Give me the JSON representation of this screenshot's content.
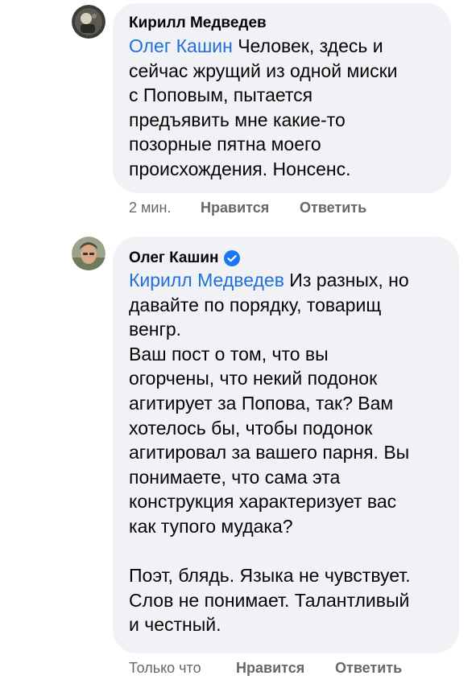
{
  "comments": [
    {
      "author": "Кирилл Медведев",
      "mention": "Олег Кашин",
      "lines": [
        " Человек, здесь и",
        "сейчас жрущий из одной миски",
        "с Поповым, пытается",
        "предъявить мне какие-то",
        "позорные пятна моего",
        "происхождения. Нонсенс."
      ],
      "time": "2 мин.",
      "like_label": "Нравится",
      "reply_label": "Ответить"
    },
    {
      "author": "Олег Кашин",
      "verified": true,
      "mention": "Кирилл Медведев",
      "lines": [
        " Из разных, но",
        "давайте по порядку, товарищ",
        "венгр.",
        "Ваш пост о том, что вы",
        "огорчены, что некий подонок",
        "агитирует за Попова, так? Вам",
        "хотелось бы, чтобы подонок",
        "агитировал за вашего парня. Вы",
        "понимаете, что сама эта",
        "конструкция характеризует вас",
        "как тупого мудака?",
        "",
        "Поэт, блядь. Языка не чувствует.",
        "Слов не понимает. Талантливый",
        "и честный."
      ],
      "time": "Только что",
      "like_label": "Нравится",
      "reply_label": "Ответить"
    }
  ],
  "colors": {
    "mention": "#216fdb",
    "bubble": "#f0f2f5",
    "meta": "#65676b",
    "verified": "#1877f2"
  },
  "icons": {
    "verified": "verified-badge-icon"
  }
}
